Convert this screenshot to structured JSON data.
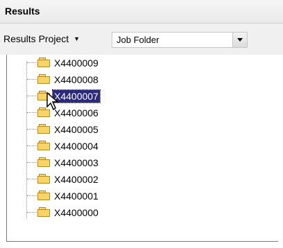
{
  "panel": {
    "title": "Results"
  },
  "toolbar": {
    "results_project_label": "Results Project",
    "combo_value": "Job Folder"
  },
  "tree": {
    "nodes": [
      {
        "label": "X4400009",
        "selected": false
      },
      {
        "label": "X4400008",
        "selected": false
      },
      {
        "label": "X4400007",
        "selected": true
      },
      {
        "label": "X4400006",
        "selected": false
      },
      {
        "label": "X4400005",
        "selected": false
      },
      {
        "label": "X4400004",
        "selected": false
      },
      {
        "label": "X4400003",
        "selected": false
      },
      {
        "label": "X4400002",
        "selected": false
      },
      {
        "label": "X4400001",
        "selected": false
      },
      {
        "label": "X4400000",
        "selected": false
      }
    ]
  },
  "icons": {
    "folder": "folder-icon",
    "dropdown": "chevron-down-icon",
    "cursor": "mouse-pointer-icon"
  },
  "colors": {
    "selection": "#2c2a7f",
    "folder": "#f7d466",
    "header_bg": "#efefef"
  }
}
